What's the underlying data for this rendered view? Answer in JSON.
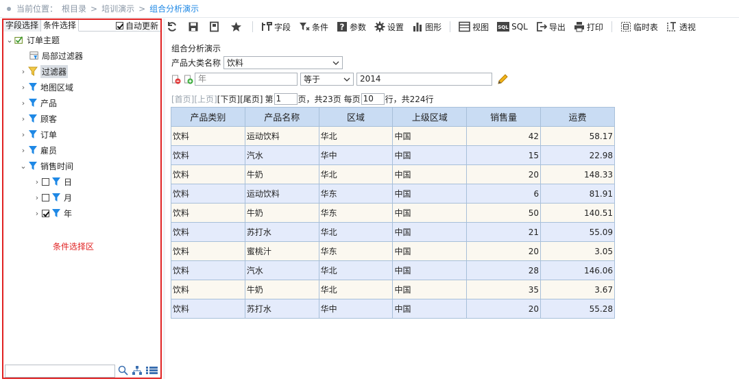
{
  "breadcrumb": {
    "label": "当前位置：",
    "root": "根目录",
    "sep": ">",
    "folder": "培训演示",
    "current": "组合分析演示"
  },
  "left": {
    "tabs": [
      "字段选择",
      "条件选择"
    ],
    "auto_update": "自动更新",
    "tree": {
      "root": "订单主题",
      "local_filter": "局部过滤器",
      "items": [
        "过滤器",
        "地图区域",
        "产品",
        "顾客",
        "订单",
        "雇员",
        "销售时间"
      ],
      "time_children": [
        "日",
        "月",
        "年"
      ]
    },
    "area_label": "条件选择区"
  },
  "toolbar": {
    "fields": "字段",
    "conditions": "条件",
    "params": "参数",
    "settings": "设置",
    "chart": "图形",
    "view": "视图",
    "sql": "SQL",
    "export": "导出",
    "print": "打印",
    "temp_table": "临时表",
    "pivot": "透视"
  },
  "report": {
    "title": "组合分析演示",
    "filter1_label": "产品大类名称",
    "filter1_value": "饮料",
    "filter2_placeholder": "年",
    "operator": "等于",
    "filter2_value": "2014"
  },
  "pager": {
    "first": "[首页]",
    "prev": "[上页]",
    "next": "[下页]",
    "last": "[尾页]",
    "page_prefix": "第",
    "page": "1",
    "page_suffix": "页，共23页 每页",
    "per_page": "10",
    "total_text": "行，共224行"
  },
  "table": {
    "headers": [
      "产品类别",
      "产品名称",
      "区域",
      "上级区域",
      "销售量",
      "运费"
    ],
    "rows": [
      [
        "饮料",
        "运动饮料",
        "华北",
        "中国",
        "42",
        "58.17"
      ],
      [
        "饮料",
        "汽水",
        "华中",
        "中国",
        "15",
        "22.98"
      ],
      [
        "饮料",
        "牛奶",
        "华北",
        "中国",
        "20",
        "148.33"
      ],
      [
        "饮料",
        "运动饮料",
        "华东",
        "中国",
        "6",
        "81.91"
      ],
      [
        "饮料",
        "牛奶",
        "华东",
        "中国",
        "50",
        "140.51"
      ],
      [
        "饮料",
        "苏打水",
        "华北",
        "中国",
        "21",
        "55.09"
      ],
      [
        "饮料",
        "蜜桃汁",
        "华东",
        "中国",
        "20",
        "3.05"
      ],
      [
        "饮料",
        "汽水",
        "华北",
        "中国",
        "28",
        "146.06"
      ],
      [
        "饮料",
        "牛奶",
        "华北",
        "中国",
        "35",
        "3.67"
      ],
      [
        "饮料",
        "苏打水",
        "华中",
        "中国",
        "20",
        "55.28"
      ]
    ]
  },
  "colors": {
    "accent": "#1e88e5",
    "highlight": "#e02020",
    "header_bg": "#c9dcf3"
  }
}
